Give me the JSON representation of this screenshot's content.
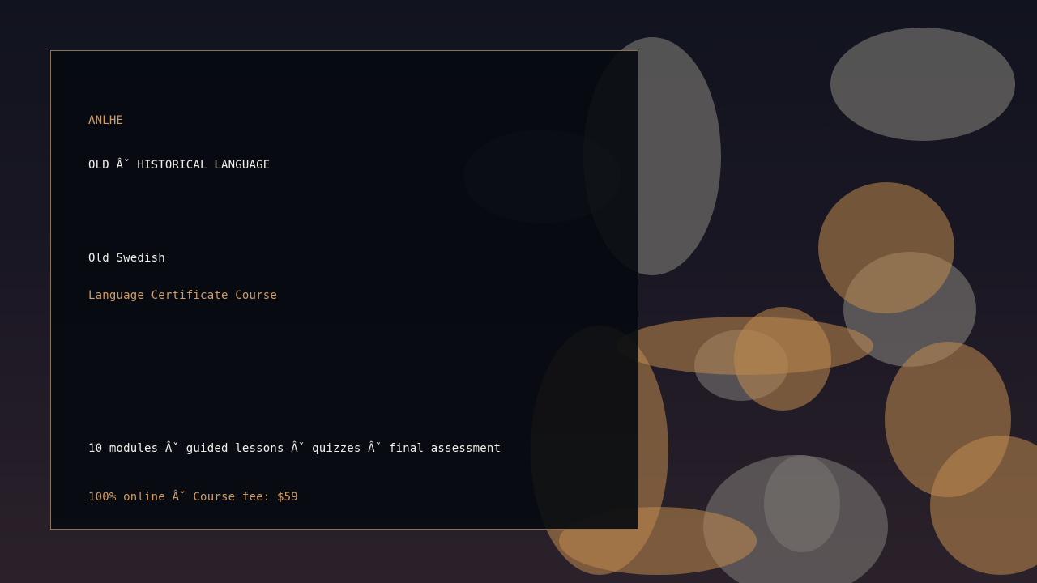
{
  "card": {
    "brand": "ANLHE",
    "category": "OLD Âˇ HISTORICAL LANGUAGE",
    "title": "Old Swedish",
    "subtitle": "Language Certificate Course",
    "details": "10 modules Âˇ guided lessons Âˇ quizzes Âˇ final assessment",
    "pricing": "100% online Âˇ Course fee: $59"
  },
  "colors": {
    "accent_gold": "#d19b61",
    "text_white": "#f1efea",
    "card_border": "#8a7358",
    "card_background": "#060a10",
    "bokeh_gold": "#c08a4e",
    "bokeh_gray": "#8a8680"
  }
}
